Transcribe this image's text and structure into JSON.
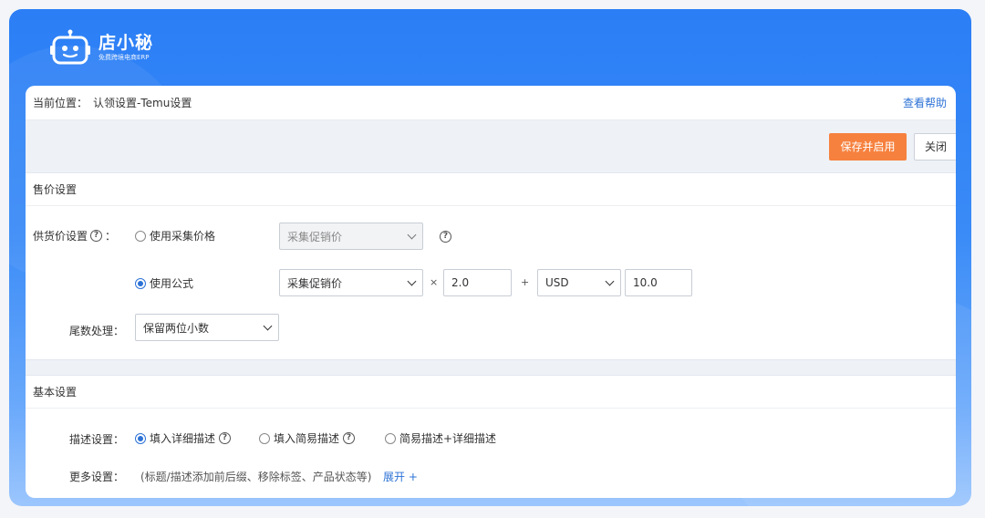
{
  "brand": {
    "name": "店小秘",
    "slogan": "免费跨境电商ERP"
  },
  "breadcrumb": {
    "prefix": "当前位置：",
    "path": "认领设置-Temu设置"
  },
  "help_link": "查看帮助",
  "toolbar": {
    "save_label": "保存并启用",
    "close_label": "关闭"
  },
  "price_section": {
    "title": "售价设置",
    "supply_label": "供货价设置",
    "option_collect": "使用采集价格",
    "collect_select": "采集促销价",
    "option_formula": "使用公式",
    "formula_select": "采集促销价",
    "multiply": "×",
    "multiplier": "2.0",
    "plus": "+",
    "currency": "USD",
    "addend": "10.0",
    "rounding_label": "尾数处理：",
    "rounding_select": "保留两位小数",
    "colon": "："
  },
  "basic_section": {
    "title": "基本设置",
    "desc_label": "描述设置：",
    "desc_options": [
      "填入详细描述",
      "填入简易描述",
      "简易描述+详细描述"
    ],
    "more_label": "更多设置：",
    "more_hint": "(标题/描述添加前后缀、移除标签、产品状态等)",
    "expand_label": "展开 +"
  },
  "colors": {
    "primary": "#2c72d6",
    "accent": "#f6813e",
    "header_bg": "#2b7ef5"
  }
}
